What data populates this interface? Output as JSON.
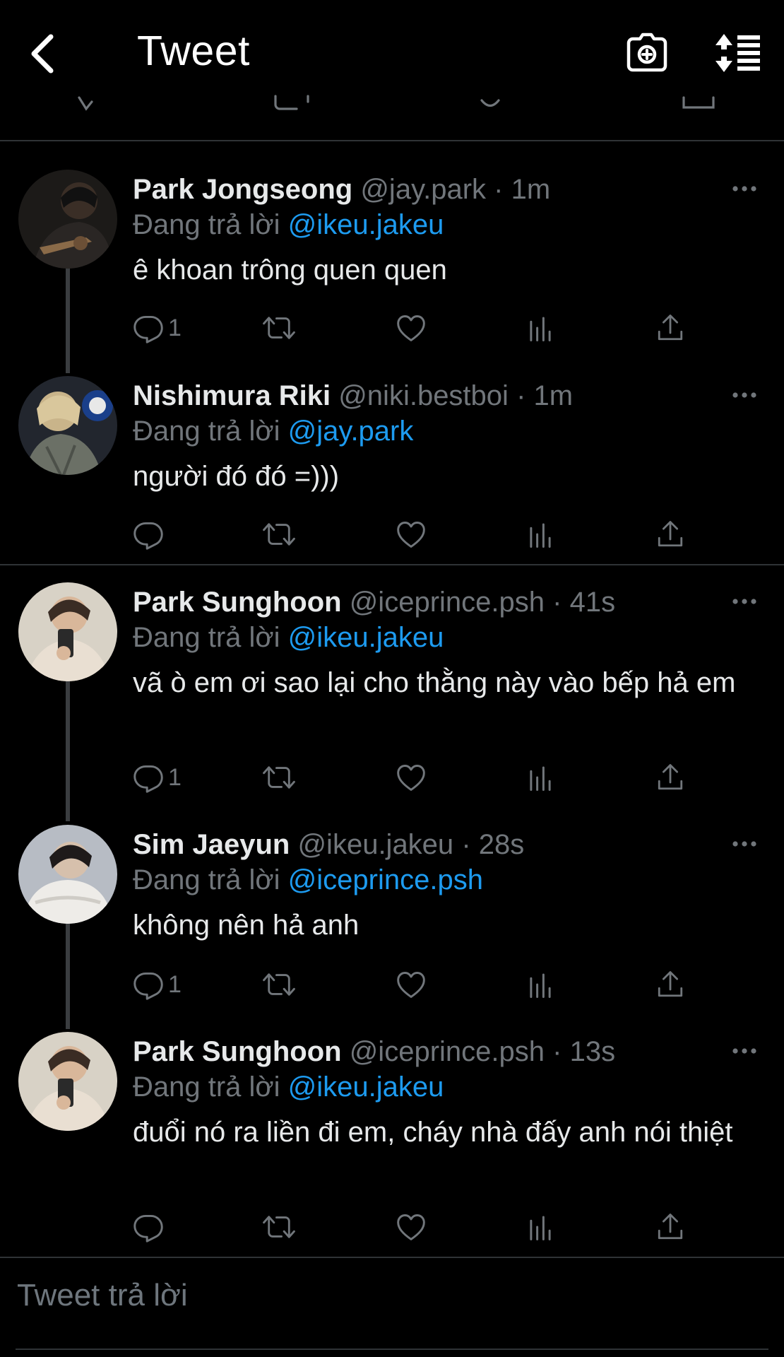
{
  "header": {
    "title": "Tweet"
  },
  "colors": {
    "background": "#000000",
    "mention": "#1d9bf0",
    "muted": "#71767b",
    "text": "#e7e9ea"
  },
  "tweets": [
    {
      "name": "Park Jongseong",
      "handle": "@jay.park",
      "time": "1m",
      "reply_prefix": "Đang trả lời",
      "reply_to": "@ikeu.jakeu",
      "text": "ê khoan trông quen quen",
      "reply_count": "1"
    },
    {
      "name": "Nishimura Riki",
      "handle": "@niki.bestboi",
      "time": "1m",
      "reply_prefix": "Đang trả lời",
      "reply_to": "@jay.park",
      "text": "người đó đó =)))",
      "reply_count": ""
    },
    {
      "name": "Park Sunghoon",
      "handle": "@iceprince.psh",
      "time": "41s",
      "reply_prefix": "Đang trả lời",
      "reply_to": "@ikeu.jakeu",
      "text": "vã ò em ơi sao lại cho thằng này vào bếp hả em",
      "reply_count": "1"
    },
    {
      "name": "Sim Jaeyun",
      "handle": "@ikeu.jakeu",
      "time": "28s",
      "reply_prefix": "Đang trả lời",
      "reply_to": "@iceprince.psh",
      "text": "không nên hả anh",
      "reply_count": "1"
    },
    {
      "name": "Park Sunghoon",
      "handle": "@iceprince.psh",
      "time": "13s",
      "reply_prefix": "Đang trả lời",
      "reply_to": "@ikeu.jakeu",
      "text": "đuổi nó ra liền đi em, cháy nhà đấy anh nói thiệt",
      "reply_count": ""
    }
  ],
  "composer": {
    "placeholder": "Tweet trả lời"
  }
}
